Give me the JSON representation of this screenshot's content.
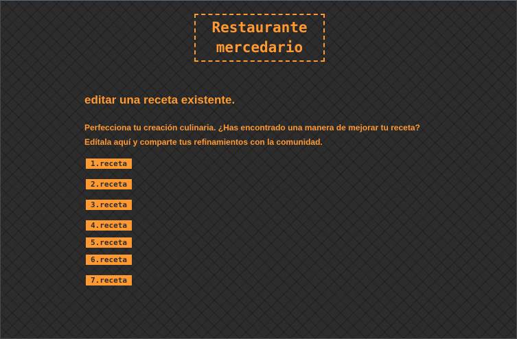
{
  "header": {
    "title_line1": "Restaurante",
    "title_line2": "mercedario"
  },
  "main": {
    "heading": "editar una receta existente.",
    "intro_line1": "Perfecciona tu creación culinaria. ¿Has encontrado una manera de mejorar tu receta?",
    "intro_line2": "Edítala aquí y comparte tus refinamientos con la comunidad.",
    "recipes": [
      {
        "label": "1.receta"
      },
      {
        "label": "2.receta"
      },
      {
        "label": "3.receta"
      },
      {
        "label": "4.receta"
      },
      {
        "label": "5.receta"
      },
      {
        "label": "6.receta"
      },
      {
        "label": "7.receta"
      }
    ]
  },
  "colors": {
    "background": "#2c2c2c",
    "accent": "#ff9a33"
  }
}
